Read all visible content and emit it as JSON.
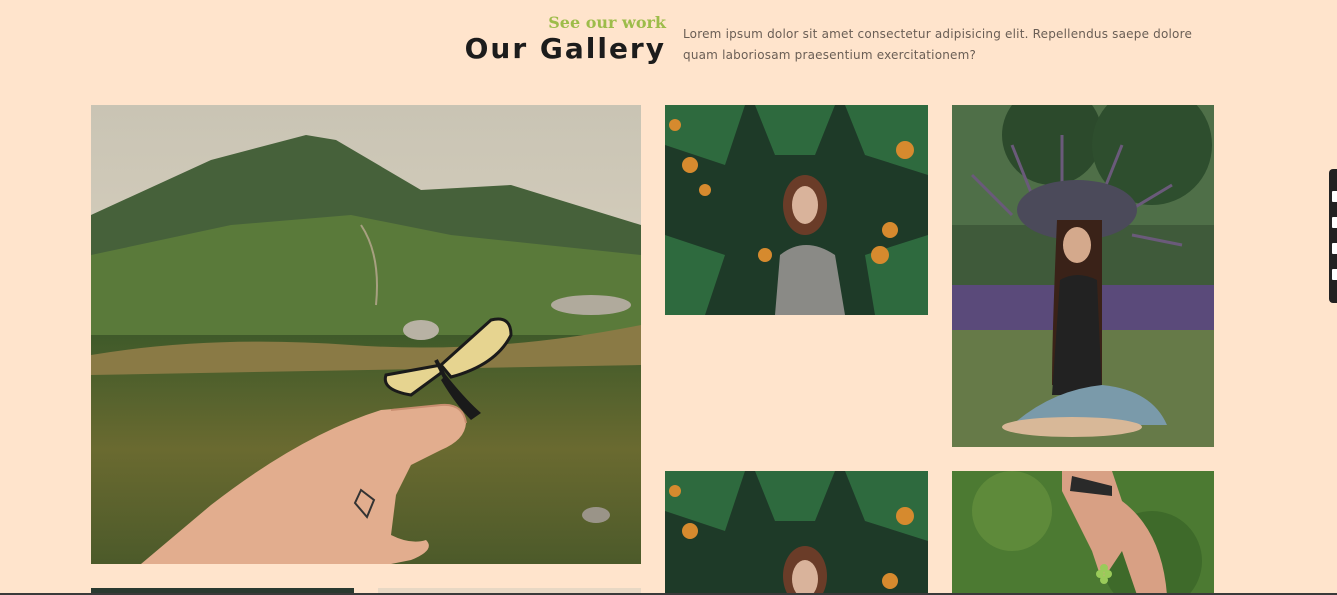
{
  "section": {
    "kicker": "See our work",
    "title": "Our Gallery",
    "description": "Lorem ipsum dolor sit amet consectetur adipisicing elit. Repellendus saepe dolore quam laboriosam praesentium exercitationem?"
  },
  "colors": {
    "background": "#ffe4cc",
    "kicker_accent": "#9dbc4a",
    "title": "#1c1c1c",
    "description": "#6a5e55"
  },
  "gallery": {
    "items": [
      {
        "name": "mountain-butterfly-photo",
        "subject": "hand holding butterfly in mountain meadow"
      },
      {
        "name": "girl-in-ferns-photo",
        "subject": "girl framed by ferns"
      },
      {
        "name": "flower-crown-photo",
        "subject": "woman with flower crown in lavender field"
      },
      {
        "name": "girl-in-ferns-photo-2",
        "subject": "girl framed by ferns"
      },
      {
        "name": "hand-clover-photo",
        "subject": "hand picking clover"
      },
      {
        "name": "partial-photo-left",
        "subject": "cropped image"
      },
      {
        "name": "partial-photo-right",
        "subject": "cropped image"
      }
    ]
  },
  "side_tools": {
    "icons": [
      "square-icon",
      "square-icon",
      "message-icon",
      "gear-icon"
    ]
  }
}
